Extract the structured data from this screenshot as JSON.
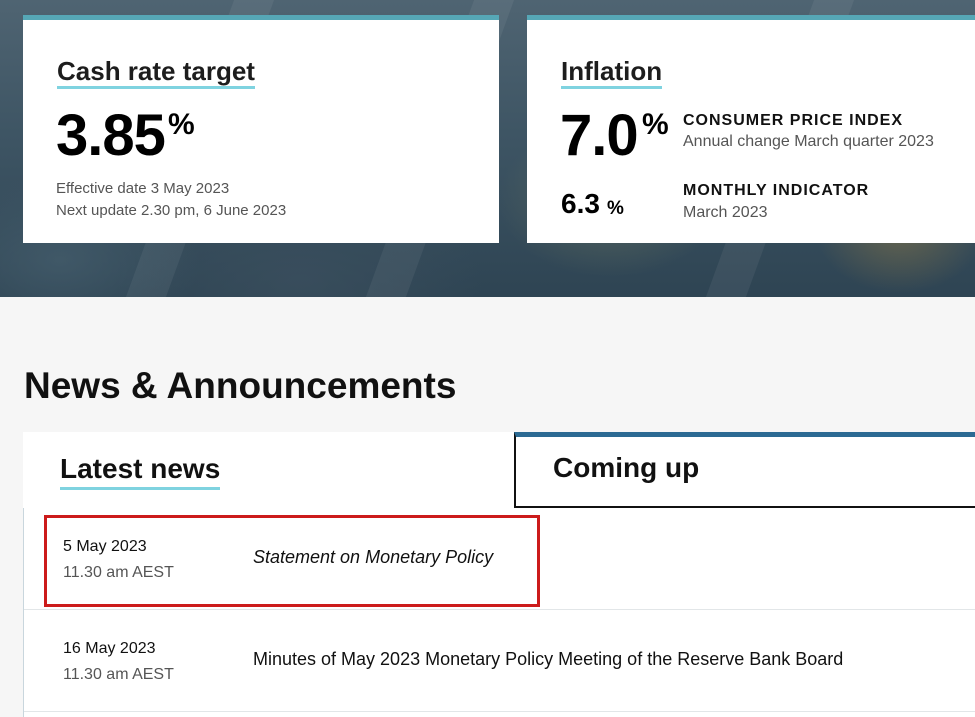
{
  "cash_rate": {
    "title": "Cash rate target",
    "value": "3.85",
    "unit": "%",
    "effective": "Effective date 3 May 2023",
    "next_update": "Next update 2.30 pm, 6 June 2023"
  },
  "inflation": {
    "title": "Inflation",
    "cpi_value": "7.0",
    "cpi_unit": "%",
    "cpi_label": "CONSUMER PRICE INDEX",
    "cpi_sub": "Annual change March quarter 2023",
    "monthly_value": "6.3",
    "monthly_unit": "%",
    "monthly_label": "MONTHLY INDICATOR",
    "monthly_sub": "March 2023"
  },
  "news": {
    "heading": "News & Announcements",
    "tabs": [
      {
        "label": "Latest news"
      },
      {
        "label": "Coming up"
      }
    ],
    "items": [
      {
        "date": "5 May 2023",
        "time": "11.30 am AEST",
        "title": "Statement on Monetary Policy"
      },
      {
        "date": "16 May 2023",
        "time": "11.30 am AEST",
        "title": "Minutes of May 2023 Monetary Policy Meeting of the Reserve Bank Board"
      }
    ]
  },
  "colors": {
    "accent_teal": "#56a7b6",
    "underline": "#7fd3e0",
    "tab_accent": "#2b6a93",
    "highlight": "#cc1b1b"
  }
}
